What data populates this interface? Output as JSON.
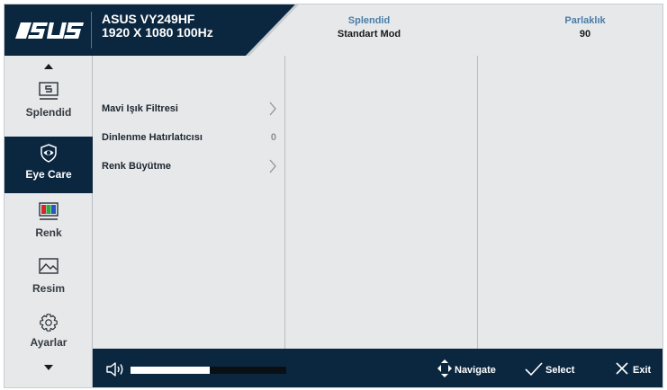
{
  "brand": {
    "logo_text": "ASUS"
  },
  "header": {
    "model": "ASUS VY249HF",
    "resolution": "1920 X 1080 100Hz",
    "splendid_label": "Splendid",
    "splendid_value": "Standart Mod",
    "brightness_label": "Parlaklık",
    "brightness_value": "90"
  },
  "nav": {
    "items": [
      {
        "label": "Splendid",
        "icon": "monitor-s-icon",
        "active": false
      },
      {
        "label": "Eye Care",
        "icon": "eye-icon",
        "active": true
      },
      {
        "label": "Renk",
        "icon": "color-bars-icon",
        "active": false
      },
      {
        "label": "Resim",
        "icon": "picture-icon",
        "active": false
      },
      {
        "label": "Ayarlar",
        "icon": "gear-icon",
        "active": false
      }
    ]
  },
  "submenu": {
    "items": [
      {
        "label": "Mavi Işık Filtresi",
        "value": "",
        "has_chevron": true
      },
      {
        "label": "Dinlenme Hatırlatıcısı",
        "value": "0",
        "has_chevron": false
      },
      {
        "label": "Renk Büyütme",
        "value": "",
        "has_chevron": true
      }
    ]
  },
  "footer": {
    "volume_level": 0.51,
    "navigate_label": "Navigate",
    "select_label": "Select",
    "exit_label": "Exit"
  },
  "colors": {
    "dark_navy": "#0b2740",
    "panel_gray": "#e6e8ea",
    "accent_blue": "#4a7da8"
  }
}
